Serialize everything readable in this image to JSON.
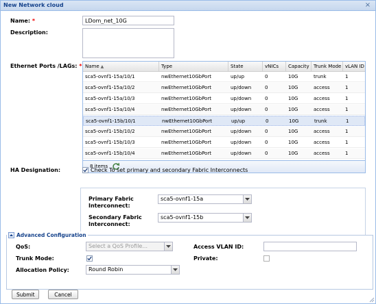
{
  "window": {
    "title": "New Network cloud",
    "close_icon": "close-icon"
  },
  "form": {
    "name_label": "Name:",
    "required_mark": "*",
    "name_value": "LDom_net_10G",
    "description_label": "Description:",
    "description_value": "",
    "ports_label": "Ethernet Ports /LAGs:",
    "ha_label": "HA Designation:"
  },
  "grid": {
    "columns": [
      "Name",
      "Type",
      "State",
      "vNICs",
      "Capacity",
      "Trunk Mode",
      "vLAN ID"
    ],
    "sort_indicator": "▲",
    "rows": [
      {
        "name": "sca5-ovnf1-15a/10/1",
        "type": "nwEthernet10GbPort",
        "state": "up/up",
        "vnics": "0",
        "capacity": "10G",
        "trunk": "trunk",
        "vlan": "1"
      },
      {
        "name": "sca5-ovnf1-15a/10/2",
        "type": "nwEthernet10GbPort",
        "state": "up/down",
        "vnics": "0",
        "capacity": "10G",
        "trunk": "access",
        "vlan": "1"
      },
      {
        "name": "sca5-ovnf1-15a/10/3",
        "type": "nwEthernet10GbPort",
        "state": "up/down",
        "vnics": "0",
        "capacity": "10G",
        "trunk": "access",
        "vlan": "1"
      },
      {
        "name": "sca5-ovnf1-15a/10/4",
        "type": "nwEthernet10GbPort",
        "state": "up/down",
        "vnics": "0",
        "capacity": "10G",
        "trunk": "access",
        "vlan": "1"
      },
      {
        "name": "sca5-ovnf1-15b/10/1",
        "type": "nwEthernet10GbPort",
        "state": "up/up",
        "vnics": "0",
        "capacity": "10G",
        "trunk": "trunk",
        "vlan": "1"
      },
      {
        "name": "sca5-ovnf1-15b/10/2",
        "type": "nwEthernet10GbPort",
        "state": "up/down",
        "vnics": "0",
        "capacity": "10G",
        "trunk": "access",
        "vlan": "1"
      },
      {
        "name": "sca5-ovnf1-15b/10/3",
        "type": "nwEthernet10GbPort",
        "state": "up/down",
        "vnics": "0",
        "capacity": "10G",
        "trunk": "access",
        "vlan": "1"
      },
      {
        "name": "sca5-ovnf1-15b/10/4",
        "type": "nwEthernet10GbPort",
        "state": "up/down",
        "vnics": "0",
        "capacity": "10G",
        "trunk": "access",
        "vlan": "1"
      }
    ],
    "selected_row": 4,
    "footer_count": "8 items"
  },
  "ha": {
    "checkbox_checked": true,
    "checkbox_text": "Check To set primary and secondary Fabric Interconnects",
    "primary_label_1": "Primary Fabric",
    "primary_label_2": "Interconnect:",
    "primary_value": "sca5-ovnf1-15a",
    "secondary_label_1": "Secondary Fabric",
    "secondary_label_2": "Interconnect:",
    "secondary_value": "sca5-ovnf1-15b"
  },
  "advanced": {
    "legend": "Advanced Configuration",
    "qos_label": "QoS:",
    "qos_placeholder": "Select a QoS Profile...",
    "access_vlan_label": "Access VLAN ID:",
    "access_vlan_value": "",
    "trunk_label": "Trunk Mode:",
    "trunk_checked": true,
    "private_label": "Private:",
    "private_checked": false,
    "alloc_label": "Allocation Policy:",
    "alloc_value": "Round Robin"
  },
  "buttons": {
    "submit": "Submit",
    "cancel": "Cancel"
  }
}
